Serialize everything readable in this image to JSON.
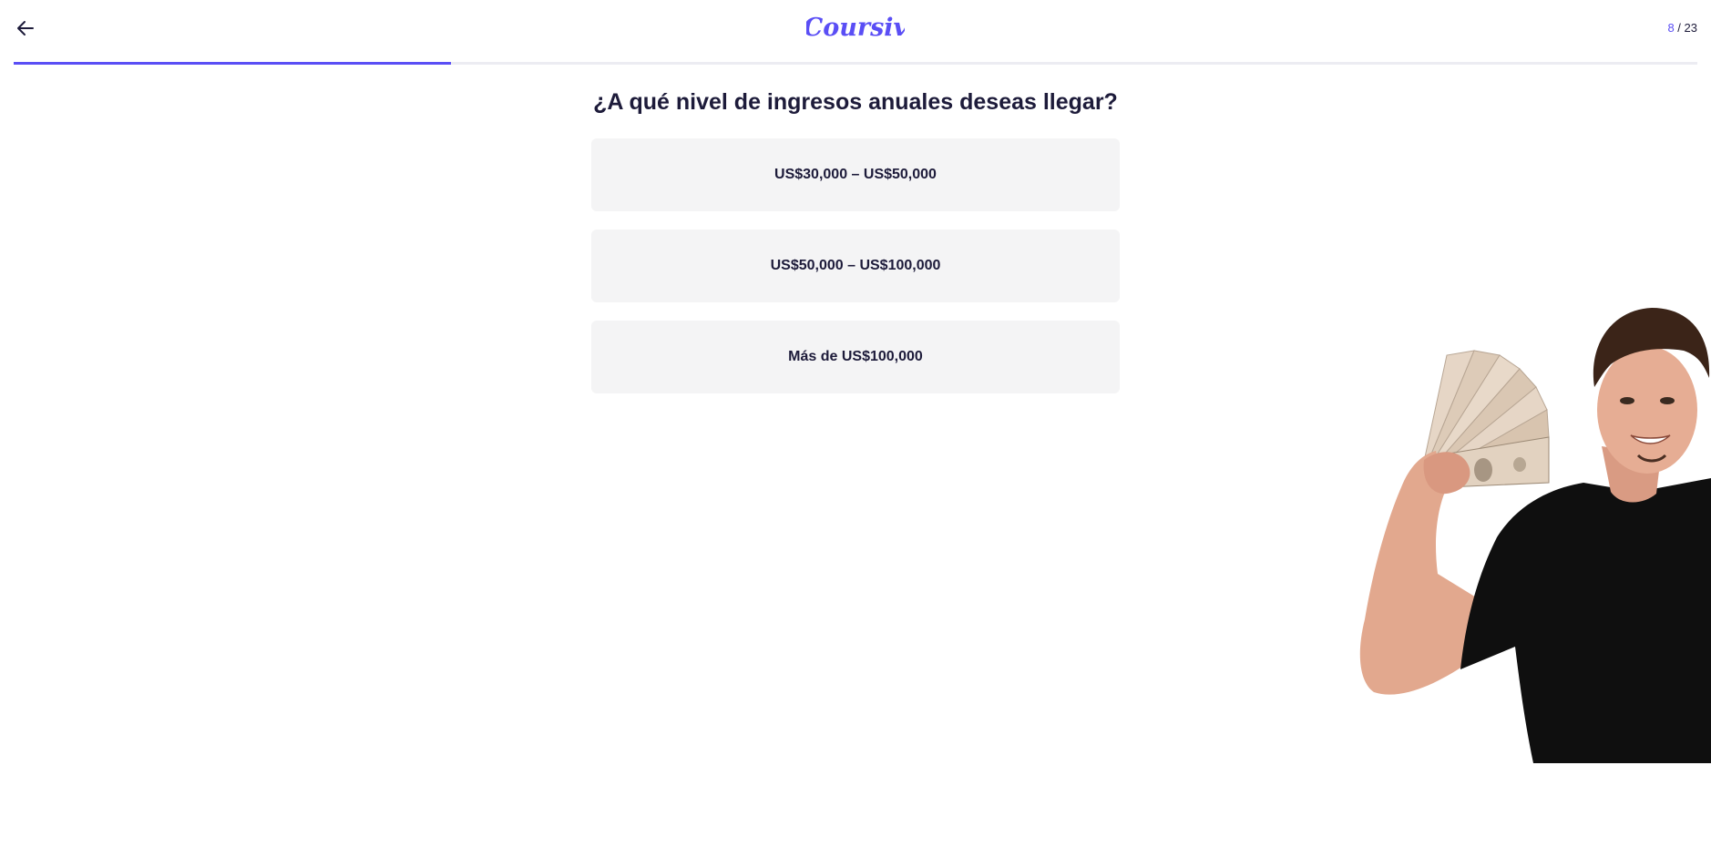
{
  "header": {
    "back_icon": "arrow-left-icon",
    "logo_text": "Coursiv",
    "progress": {
      "current": "8",
      "separator": " / ",
      "total": "23",
      "fraction": 0.26
    }
  },
  "colors": {
    "accent": "#5a4ef5",
    "text": "#1d1b3a",
    "option_bg": "#f4f4f5"
  },
  "question": {
    "title": "¿A qué nivel de ingresos anuales deseas llegar?"
  },
  "options": [
    {
      "label": "US$30,000 – US$50,000"
    },
    {
      "label": "US$50,000 – US$100,000"
    },
    {
      "label": "Más de US$100,000"
    }
  ]
}
